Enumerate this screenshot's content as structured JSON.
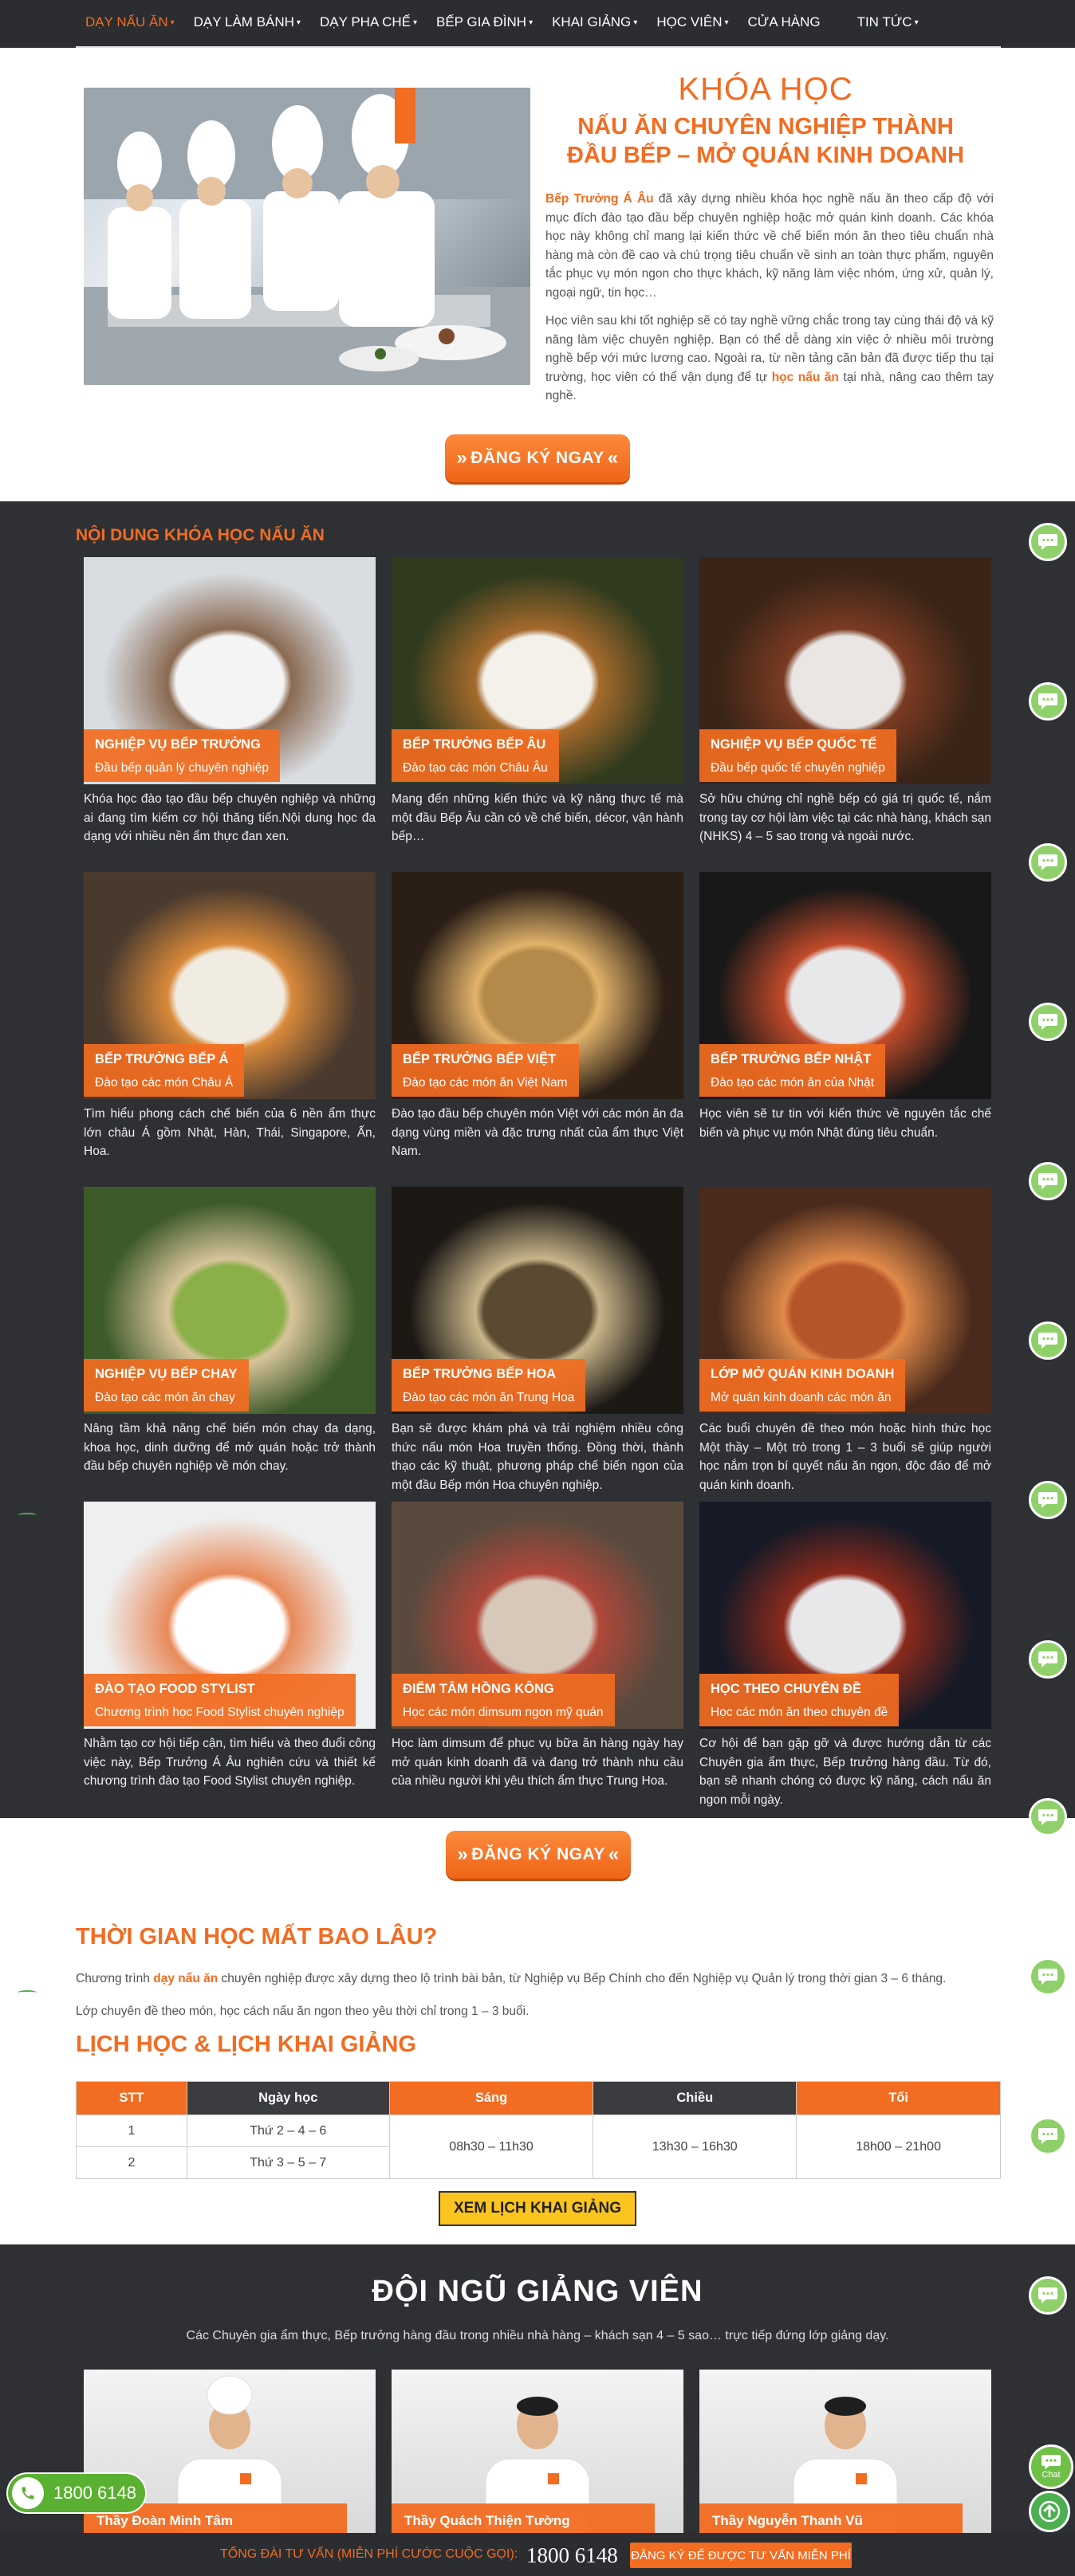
{
  "nav": {
    "items": [
      {
        "label": "DẠY NẤU ĂN",
        "dropdown": true,
        "active": true
      },
      {
        "label": "DẠY LÀM BÁNH",
        "dropdown": true
      },
      {
        "label": "DẠY PHA CHẾ",
        "dropdown": true
      },
      {
        "label": "BẾP GIA ĐÌNH",
        "dropdown": true
      },
      {
        "label": "KHAI GIẢNG",
        "dropdown": true
      },
      {
        "label": "HỌC VIÊN",
        "dropdown": true
      },
      {
        "label": "CỬA HÀNG",
        "dropdown": false
      },
      {
        "label": "TIN TỨC",
        "dropdown": true
      }
    ]
  },
  "intro": {
    "title1": "KHÓA HỌC",
    "title2": "NẤU ĂN CHUYÊN NGHIỆP THÀNH",
    "title3": "ĐẦU BẾP – MỞ QUÁN KINH DOANH",
    "p1_highlight": "Bếp Trưởng Á Âu",
    "p1_rest": " đã xây dựng nhiều khóa học nghề nấu ăn theo cấp độ với mục đích đào tạo đầu bếp chuyên nghiệp hoặc mở quán kinh doanh. Các khóa học này không chỉ mang lại kiến thức về chế biến món ăn theo tiêu chuẩn nhà hàng mà còn đề cao và chú trọng tiêu chuẩn về sinh an toàn thực phẩm, nguyên tắc phục vụ món ngon cho thực khách, kỹ năng làm việc nhóm, ứng xử, quản lý, ngoại ngữ, tin học…",
    "p2_start": "Học viên sau khi tốt nghiệp sẽ có tay nghề vững chắc trong tay cùng thái độ và kỹ năng làm việc chuyên nghiệp. Bạn có thể dễ dàng xin việc ở nhiều môi trường nghề bếp với mức lương cao. Ngoài ra, từ nền tảng căn bản đã được tiếp thu tại trường, học viên có thể vận dụng để tự ",
    "p2_highlight": "học nấu ăn",
    "p2_end": " tại nhà, nâng cao thêm tay nghề."
  },
  "register_button": {
    "label": "ĐĂNG KÝ NGAY",
    "left_chevrons": "»",
    "right_chevrons": "«"
  },
  "courses": {
    "heading": "NỘI DUNG KHÓA HỌC NẤU ĂN",
    "items": [
      {
        "title": "NGHIỆP VỤ BẾP TRƯỞNG",
        "subtitle": "Đầu bếp quản lý chuyên nghiệp",
        "desc": "Khóa học đào tạo đầu bếp chuyên nghiệp và những ai đang tìm kiếm cơ hội thăng tiến.Nội dung học đa dạng với nhiều nền ẩm thực đan xen.",
        "palette": [
          "#d9dde2",
          "#f4f4f4",
          "#8a6a52"
        ]
      },
      {
        "title": "BẾP TRƯỞNG BẾP ÂU",
        "subtitle": "Đào tạo các món Châu Âu",
        "desc": "Mang đến những kiến thức và kỹ năng thực tế mà một đầu Bếp Âu cần có về chế biến, décor, vận hành bếp…",
        "palette": [
          "#2f3a1e",
          "#f3f1ea",
          "#a56a2c"
        ]
      },
      {
        "title": "NGHIỆP VỤ BẾP QUỐC TẾ",
        "subtitle": "Đầu bếp quốc tế chuyên nghiệp",
        "desc": "Sở hữu chứng chỉ nghề bếp có giá trị quốc tế, nắm trong tay cơ hội làm việc tại các nhà hàng, khách sạn (NHKS) 4 – 5 sao trong và ngoài nước.",
        "palette": [
          "#3a2418",
          "#e9e6e3",
          "#7a3b22"
        ]
      },
      {
        "title": "BẾP TRƯỞNG BẾP Á",
        "subtitle": "Đào tạo các món Châu Á",
        "desc": "Tìm hiểu phong cách chế biến của 6 nền ẩm thực lớn châu Á gồm Nhật, Hàn, Thái, Singapore, Ấn, Hoa.",
        "palette": [
          "#4a3a2e",
          "#f1ece2",
          "#d98a3a"
        ]
      },
      {
        "title": "BẾP TRƯỞNG BẾP VIỆT",
        "subtitle": "Đào tạo các món ăn Việt Nam",
        "desc": "Đào tạo đầu bếp chuyên món Việt với các món ăn đa dạng vùng miền và đặc trưng nhất của ẩm thực Việt Nam.",
        "palette": [
          "#2a1e16",
          "#b48a4a",
          "#e2b36a"
        ]
      },
      {
        "title": "BẾP TRƯỞNG BẾP NHẬT",
        "subtitle": "Đào tạo các món ăn của Nhật",
        "desc": "Học viên sẽ tư tin với kiến thức về nguyên tắc chế biến và phục vụ món Nhật đúng tiêu chuẩn.",
        "palette": [
          "#181818",
          "#e8e8ea",
          "#c04a2a"
        ]
      },
      {
        "title": "NGHIỆP VỤ BẾP CHAY",
        "subtitle": "Đào tạo các món ăn chay",
        "desc": "Nâng tầm khả năng chế biến món chay đa dạng, khoa học, dinh dưỡng để mở quán hoặc trở thành đầu bếp chuyên nghiệp về món chay.",
        "palette": [
          "#3d5a2a",
          "#8bb04a",
          "#d8c49a"
        ]
      },
      {
        "title": "BẾP TRƯỞNG BẾP HOA",
        "subtitle": "Đào tạo các món ăn Trung Hoa",
        "desc": "Bạn sẽ được khám phá và trải nghiệm nhiều công thức nấu món Hoa truyền thống. Đồng thời, thành thạo các kỹ thuật, phương pháp chế biến ngon của một đầu Bếp món Hoa chuyên nghiệp.",
        "palette": [
          "#1c1814",
          "#5a4a32",
          "#c9b58a"
        ]
      },
      {
        "title": "LỚP MỞ QUÁN KINH DOANH",
        "subtitle": "Mở quán kinh doanh các món ăn",
        "desc": "Các buổi chuyên đề theo món hoặc hình thức học Một thầy – Một trò trong 1 – 3 buổi sẽ giúp người học nắm trọn bí quyết nấu ăn ngon, độc đáo để mở quán kinh doanh.",
        "palette": [
          "#4a2a1c",
          "#b5552a",
          "#e08a4a"
        ]
      },
      {
        "title": "ĐÀO TẠO FOOD STYLIST",
        "subtitle": "Chương trình học Food Stylist chuyên nghiệp",
        "desc": "Nhằm tạo cơ hội tiếp cận, tìm hiểu và theo đuổi công việc này, Bếp Trưởng Á Âu nghiên cứu và thiết kế chương trình đào tạo Food Stylist chuyên nghiệp.",
        "palette": [
          "#eef0f0",
          "#ffffff",
          "#e88a5a"
        ]
      },
      {
        "title": "ĐIỂM TÂM HỒNG KÔNG",
        "subtitle": "Học các món dimsum ngon mỹ quán",
        "desc": "Học làm dimsum để phục vụ bữa ăn hàng ngày hay mở quán kinh doanh đã và đang trở thành nhu cầu của nhiều người khi yêu thích ẩm thực Trung Hoa.",
        "palette": [
          "#5a4a3e",
          "#d8c8ba",
          "#b0483a"
        ]
      },
      {
        "title": "HỌC THEO CHUYÊN ĐỀ",
        "subtitle": "Học các món ăn theo chuyên đề",
        "desc": "Cơ hội để bạn gặp gỡ và được hướng dẫn từ các Chuyên gia ẩm thực, Bếp trưởng hàng đầu. Từ đó, bạn sẽ nhanh chóng có được kỹ năng, cách nấu ăn ngon mỗi ngày.",
        "palette": [
          "#161a26",
          "#e8e8ea",
          "#8a2a1c"
        ]
      }
    ]
  },
  "duration": {
    "title": "THỜI GIAN HỌC MẤT BAO LÂU?",
    "p1_start": "Chương trình ",
    "p1_highlight": "dạy nấu ăn",
    "p1_end": " chuyên nghiệp được xây dựng theo lộ trình bài bản, từ Nghiệp vụ Bếp Chính cho đến Nghiệp vụ Quản lý trong thời gian 3 – 6 tháng.",
    "p2": "Lớp chuyên đề theo món, học cách nấu ăn ngon theo yêu thời chỉ trong 1 – 3 buổi."
  },
  "schedule": {
    "title": "LỊCH HỌC & LỊCH KHAI GIẢNG",
    "headers": [
      "STT",
      "Ngày học",
      "Sáng",
      "Chiều",
      "Tối"
    ],
    "rows": [
      {
        "stt": "1",
        "days": "Thứ 2 – 4 – 6"
      },
      {
        "stt": "2",
        "days": "Thứ 3 – 5 – 7"
      }
    ],
    "morning": "08h30 – 11h30",
    "afternoon": "13h30 – 16h30",
    "evening": "18h00 – 21h00",
    "button": "XEM LỊCH KHAI GIẢNG"
  },
  "teachers": {
    "title": "ĐỘI NGŨ GIẢNG VIÊN",
    "subtitle": "Các Chuyên gia ẩm thực, Bếp trưởng hàng đầu trong nhiều nhà hàng – khách sạn 4 – 5 sao… trực tiếp đứng lớp giảng dạy.",
    "items": [
      {
        "name": "Thầy Đoàn Minh Tâm"
      },
      {
        "name": "Thầy Quách Thiện Tường"
      },
      {
        "name": "Thầy Nguyễn Thanh Vũ"
      }
    ]
  },
  "bottom_bar": {
    "text": "TỔNG ĐÀI TƯ VẤN (MIỄN PHÍ CƯỚC CUỘC GỌI):",
    "phone": "1800 6148",
    "button": "ĐĂNG KÝ ĐỂ ĐƯỢC TƯ VẤN MIỄN PHÍ"
  },
  "float": {
    "phone": "1800 6148",
    "chat_label": "Chat"
  },
  "colors": {
    "accent": "#f26c21",
    "dark": "#2e3034",
    "chat_green": "#8fd06a",
    "cta_yellow": "#fcc41f"
  }
}
